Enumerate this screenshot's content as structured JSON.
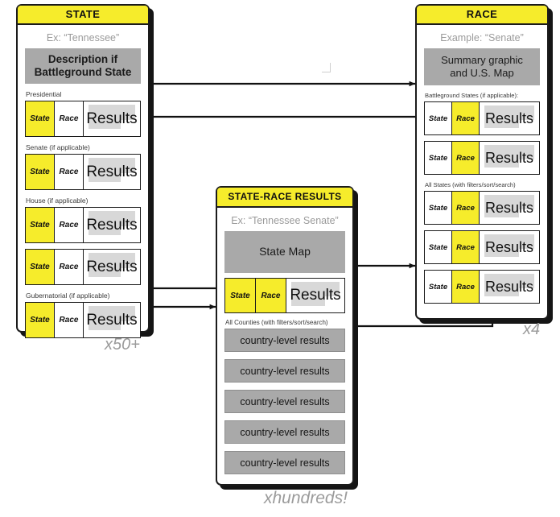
{
  "diagram": {
    "marker_square": "white-square-marker"
  },
  "state_panel": {
    "title": "STATE",
    "example": "Ex: “Tennessee”",
    "description_block": "Description if\nBattleground State",
    "multiplier": "x50+",
    "sections": [
      {
        "label": "Presidential",
        "rows": [
          {
            "state": "State",
            "race": "Race",
            "results": "Results"
          }
        ]
      },
      {
        "label": "Senate (if applicable)",
        "rows": [
          {
            "state": "State",
            "race": "Race",
            "results": "Results"
          }
        ]
      },
      {
        "label": "House (if applicable)",
        "rows": [
          {
            "state": "State",
            "race": "Race",
            "results": "Results"
          },
          {
            "state": "State",
            "race": "Race",
            "results": "Results"
          }
        ]
      },
      {
        "label": "Gubernatorial (if applicable)",
        "rows": [
          {
            "state": "State",
            "race": "Race",
            "results": "Results"
          }
        ]
      }
    ]
  },
  "race_panel": {
    "title": "RACE",
    "example": "Example: “Senate”",
    "summary_block": "Summary graphic\nand U.S. Map",
    "multiplier": "x4",
    "sections": [
      {
        "label": "Battleground States (if applicable):",
        "rows": [
          {
            "state": "State",
            "race": "Race",
            "results": "Results"
          },
          {
            "state": "State",
            "race": "Race",
            "results": "Results"
          }
        ]
      },
      {
        "label": "All States (with filters/sort/search)",
        "rows": [
          {
            "state": "State",
            "race": "Race",
            "results": "Results"
          },
          {
            "state": "State",
            "race": "Race",
            "results": "Results"
          },
          {
            "state": "State",
            "race": "Race",
            "results": "Results"
          }
        ]
      }
    ]
  },
  "state_race_panel": {
    "title": "STATE-RACE RESULTS",
    "example": "Ex: “Tennessee Senate”",
    "map_block": "State Map",
    "multiplier": "xhundreds!",
    "main_row": {
      "state": "State",
      "race": "Race",
      "results": "Results"
    },
    "counties_label": "All Counties (with filters/sort/search)",
    "counties": [
      "country-level results",
      "country-level results",
      "country-level results",
      "country-level results",
      "country-level results"
    ]
  },
  "colors": {
    "highlight": "#F6EC2B",
    "gray": "#A9A9A9",
    "light_gray": "#D8D8D8",
    "ink": "#1b1b1b",
    "muted": "#9b9b9b"
  }
}
